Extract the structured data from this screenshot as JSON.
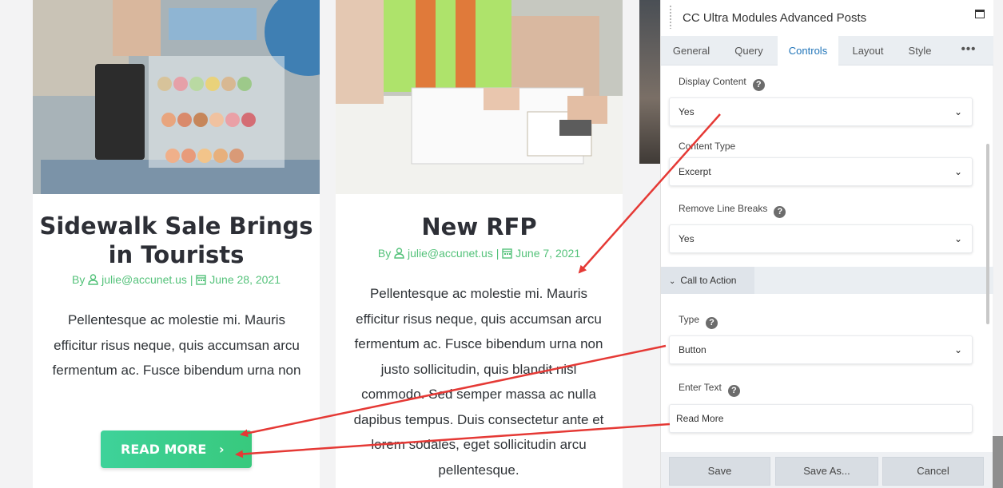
{
  "cards": [
    {
      "title": "Sidewalk Sale Brings in Tourists",
      "meta_by": "By",
      "author": "julie@accunet.us",
      "separator": "|",
      "date": "June 28, 2021",
      "excerpt": "Pellentesque ac molestie mi. Mauris efficitur risus neque, quis accumsan arcu fermentum ac. Fusce bibendum urna non",
      "button_label": "READ MORE",
      "button_icon": "chevron-right-icon"
    },
    {
      "title": "New RFP",
      "meta_by": "By",
      "author": "julie@accunet.us",
      "separator": "|",
      "date": "June 7, 2021",
      "excerpt": "Pellentesque ac molestie mi. Mauris efficitur risus neque, quis accumsan arcu fermentum ac. Fusce bibendum urna non justo sollicitudin, quis blandit nisl commodo. Sed semper massa ac nulla dapibus tempus. Duis consectetur ante et lorem sodales, eget sollicitudin arcu pellentesque."
    }
  ],
  "panel": {
    "title": "CC Ultra Modules Advanced Posts",
    "tabs": [
      {
        "label": "General",
        "active": false
      },
      {
        "label": "Query",
        "active": false
      },
      {
        "label": "Controls",
        "active": true
      },
      {
        "label": "Layout",
        "active": false
      },
      {
        "label": "Style",
        "active": false
      },
      {
        "label": "•••",
        "active": false
      }
    ],
    "fields": {
      "display_content": {
        "label": "Display Content",
        "value": "Yes"
      },
      "content_type": {
        "label": "Content Type",
        "value": "Excerpt"
      },
      "remove_line_breaks": {
        "label": "Remove Line Breaks",
        "value": "Yes"
      },
      "section": {
        "label": "Call to Action"
      },
      "type": {
        "label": "Type",
        "value": "Button"
      },
      "enter_text": {
        "label": "Enter Text",
        "value": "Read More"
      }
    },
    "help_glyph": "?",
    "buttons": {
      "save": "Save",
      "save_as": "Save As...",
      "cancel": "Cancel"
    }
  },
  "colors": {
    "accent_green": "#38c97d",
    "meta_green": "#54c27a",
    "active_tab_blue": "#2175b9",
    "annotation_red": "#e53935"
  }
}
